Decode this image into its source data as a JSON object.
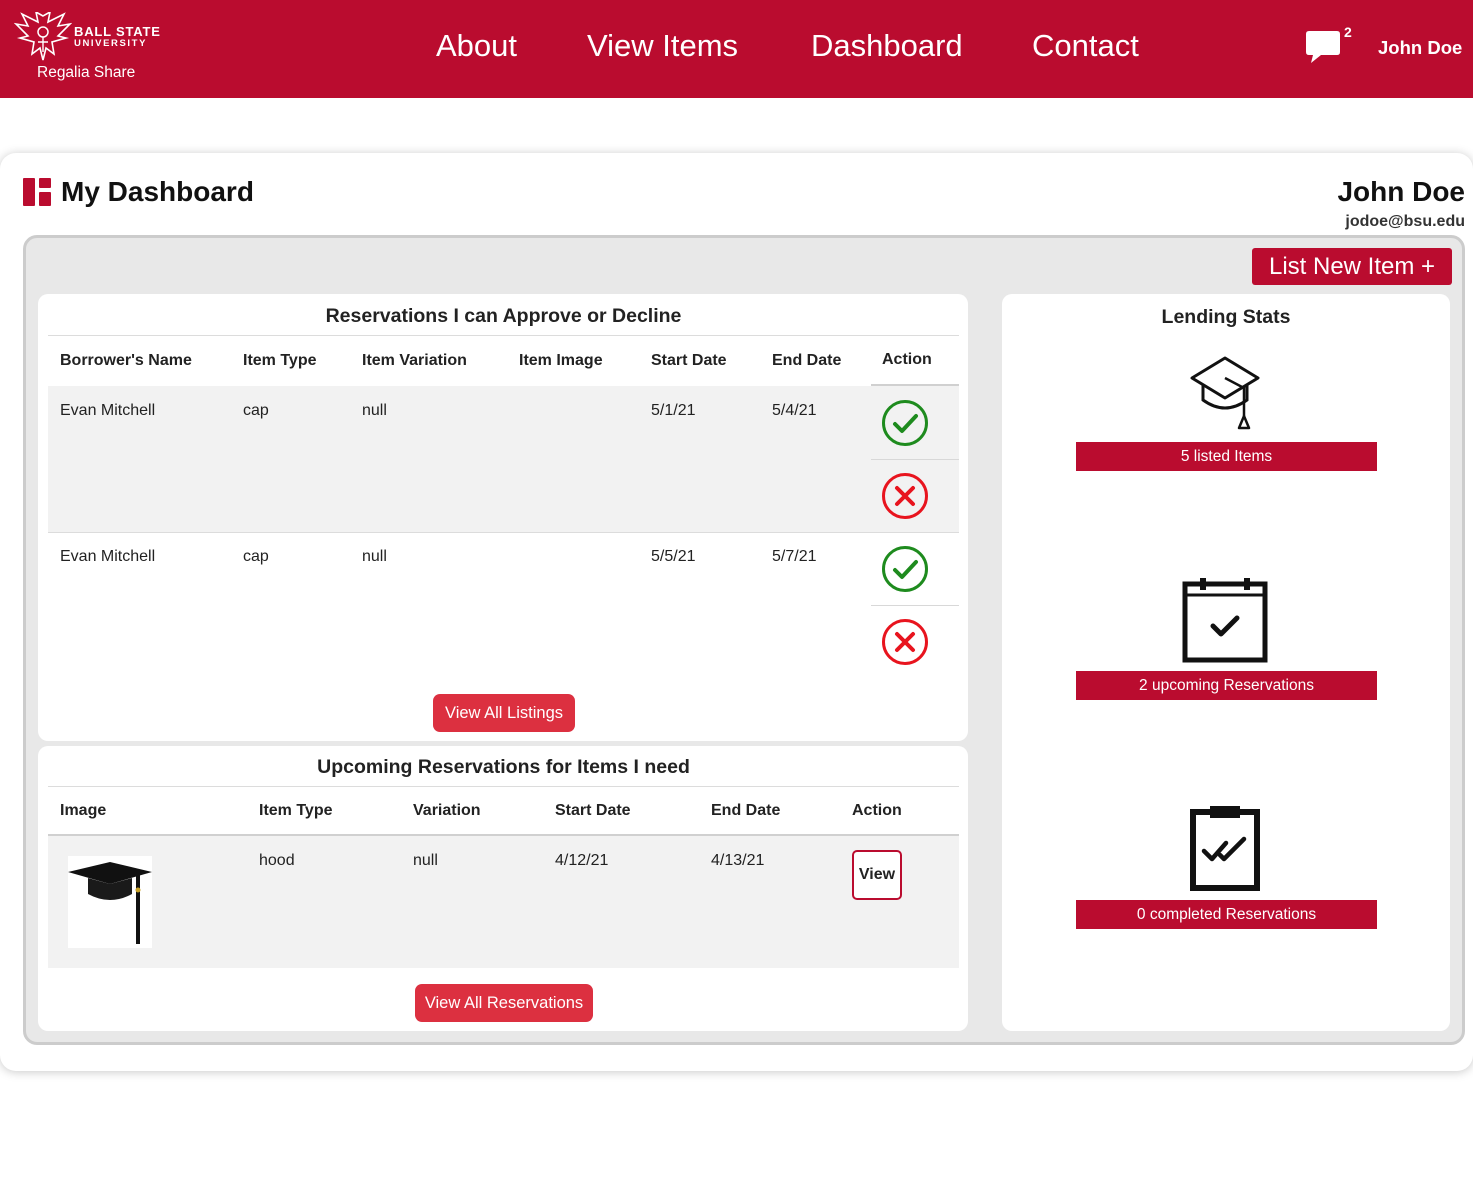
{
  "nav": {
    "logo_line1": "BALL STATE",
    "logo_line2": "UNIVERSITY",
    "brand": "Regalia Share",
    "links": [
      "About",
      "View Items",
      "Dashboard",
      "Contact"
    ],
    "message_count": "2",
    "user_name": "John Doe"
  },
  "dashboard": {
    "title": "My Dashboard",
    "profile_name": "John Doe",
    "profile_email": "jodoe@bsu.edu",
    "list_new_item": "List New Item +"
  },
  "approvals": {
    "title": "Reservations I can Approve or Decline",
    "headers": [
      "Borrower's Name",
      "Item Type",
      "Item Variation",
      "Item Image",
      "Start Date",
      "End Date",
      "Action"
    ],
    "rows": [
      {
        "borrower": "Evan Mitchell",
        "type": "cap",
        "variation": "null",
        "image": "",
        "start": "5/1/21",
        "end": "5/4/21"
      },
      {
        "borrower": "Evan Mitchell",
        "type": "cap",
        "variation": "null",
        "image": "",
        "start": "5/5/21",
        "end": "5/7/21"
      }
    ],
    "view_all_label": "View All Listings"
  },
  "upcoming": {
    "title": "Upcoming Reservations for Items I need",
    "headers": [
      "Image",
      "Item Type",
      "Variation",
      "Start Date",
      "End Date",
      "Action"
    ],
    "rows": [
      {
        "image_icon": "graduation-cap-image",
        "type": "hood",
        "variation": "null",
        "start": "4/12/21",
        "end": "4/13/21",
        "action": "View"
      }
    ],
    "view_all_label": "View All Reservations"
  },
  "stats": {
    "title": "Lending Stats",
    "items": [
      {
        "icon": "graduation-cap-icon",
        "label": "5 listed Items"
      },
      {
        "icon": "calendar-check-icon",
        "label": "2 upcoming Reservations"
      },
      {
        "icon": "clipboard-check-icon",
        "label": "0 completed Reservations"
      }
    ]
  },
  "colors": {
    "brand_red": "#ba0c2f",
    "button_red": "#dc3040",
    "approve_green": "#1e8b1e",
    "decline_red": "#e8141e"
  }
}
